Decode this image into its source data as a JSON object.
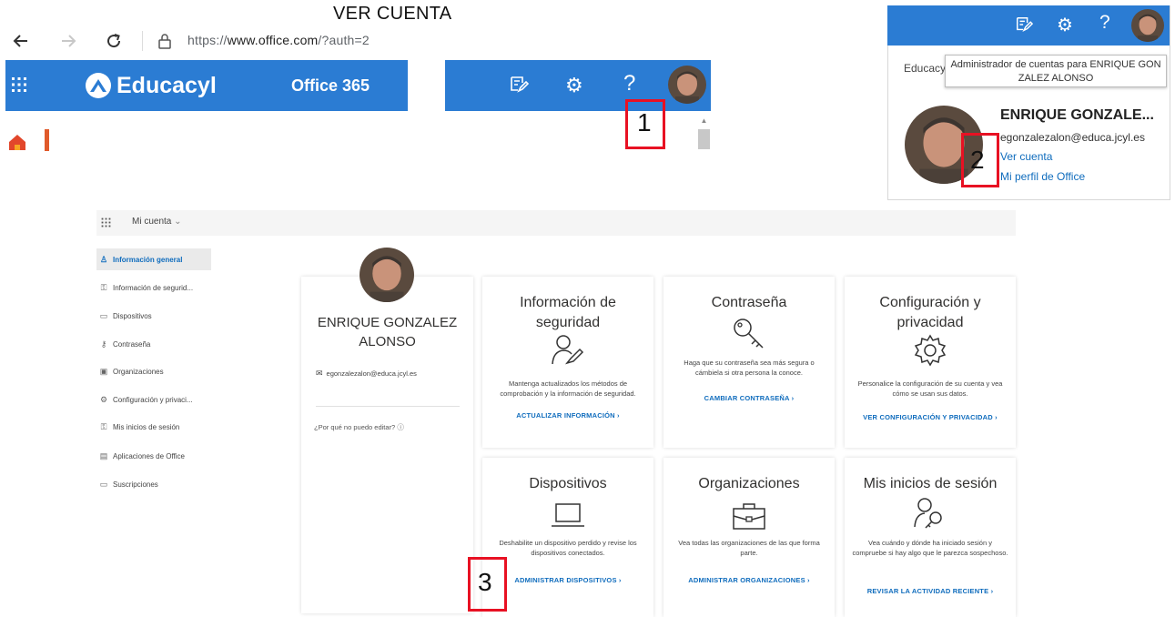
{
  "page_title": "VER CUENTA",
  "browser": {
    "url_prefix": "https://",
    "url_domain": "www.office.com",
    "url_path": "/?auth=2"
  },
  "header": {
    "brand": "Educacyl",
    "product": "Office 365"
  },
  "steps": {
    "one": "1",
    "two": "2",
    "three": "3"
  },
  "account_panel": {
    "org_partial": "Educacy",
    "tooltip": "Administrador de cuentas para ENRIQUE GON ZALEZ ALONSO",
    "name": "ENRIQUE GONZALE...",
    "email": "egonzalezalon@educa.jcyl.es",
    "view_account": "Ver cuenta",
    "office_profile": "Mi perfil de Office"
  },
  "my_account": {
    "title": "Mi cuenta",
    "sidebar": [
      {
        "label": "Información general",
        "icon": "person-icon",
        "glyph": "♙"
      },
      {
        "label": "Información de segurid...",
        "icon": "security-info-icon",
        "glyph": "⚿"
      },
      {
        "label": "Dispositivos",
        "icon": "laptop-icon",
        "glyph": "▭"
      },
      {
        "label": "Contraseña",
        "icon": "key-icon",
        "glyph": "⚷"
      },
      {
        "label": "Organizaciones",
        "icon": "briefcase-icon",
        "glyph": "▣"
      },
      {
        "label": "Configuración y privaci...",
        "icon": "gear-icon",
        "glyph": "⚙"
      },
      {
        "label": "Mis inicios de sesión",
        "icon": "signin-icon",
        "glyph": "⚿"
      },
      {
        "label": "Aplicaciones de Office",
        "icon": "apps-icon",
        "glyph": "▤"
      },
      {
        "label": "Suscripciones",
        "icon": "subscription-icon",
        "glyph": "▭"
      }
    ],
    "profile": {
      "name_line1": "ENRIQUE GONZALEZ",
      "name_line2": "ALONSO",
      "email": "egonzalezalon@educa.jcyl.es",
      "why_cant_edit": "¿Por qué no puedo editar?"
    },
    "cards": [
      {
        "title_line1": "Información de",
        "title_line2": "seguridad",
        "desc": "Mantenga actualizados los métodos de comprobación y la información de seguridad.",
        "link": "ACTUALIZAR INFORMACIÓN  ›",
        "icon": "security-info-icon"
      },
      {
        "title_line1": "Contraseña",
        "title_line2": "",
        "desc": "Haga que su contraseña sea más segura o cámbiela si otra persona la conoce.",
        "link": "CAMBIAR CONTRASEÑA  ›",
        "icon": "key-icon"
      },
      {
        "title_line1": "Configuración y",
        "title_line2": "privacidad",
        "desc": "Personalice la configuración de su cuenta y vea cómo se usan sus datos.",
        "link": "VER CONFIGURACIÓN Y PRIVACIDAD  ›",
        "icon": "gear-icon"
      },
      {
        "title_line1": "Dispositivos",
        "title_line2": "",
        "desc": "Deshabilite un dispositivo perdido y revise los dispositivos conectados.",
        "link": "ADMINISTRAR DISPOSITIVOS  ›",
        "icon": "laptop-icon"
      },
      {
        "title_line1": "Organizaciones",
        "title_line2": "",
        "desc": "Vea todas las organizaciones de las que forma parte.",
        "link": "ADMINISTRAR ORGANIZACIONES  ›",
        "icon": "briefcase-icon"
      },
      {
        "title_line1": "Mis inicios de sesión",
        "title_line2": "",
        "desc": "Vea cuándo y dónde ha iniciado sesión y compruebe si hay algo que le parezca sospechoso.",
        "link": "REVISAR LA ACTIVIDAD RECIENTE  ›",
        "icon": "signin-icon"
      }
    ]
  },
  "colors": {
    "header_blue": "#2b7cd3",
    "link_blue": "#0f6cbd",
    "highlight_red": "#e81123"
  }
}
